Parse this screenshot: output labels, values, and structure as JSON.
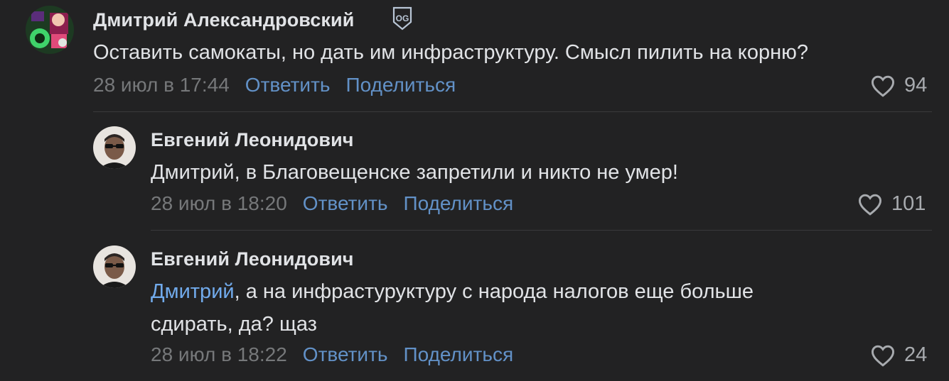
{
  "comments": [
    {
      "author": "Дмитрий Александровский",
      "badge": "OG",
      "text": "Оставить самокаты, но дать им инфраструктуру. Смысл пилить на корню?",
      "date": "28 июл в 17:44",
      "reply_label": "Ответить",
      "share_label": "Поделиться",
      "likes": "94"
    },
    {
      "author": "Евгений Леонидович",
      "text": "Дмитрий, в Благовещенске запретили и никто не умер!",
      "date": "28 июл в 18:20",
      "reply_label": "Ответить",
      "share_label": "Поделиться",
      "likes": "101"
    },
    {
      "author": "Евгений Леонидович",
      "mention": "Дмитрий",
      "text_line1": ", а на инфрастуруктуру с народа налогов еще больше",
      "text_line2": "сдирать, да? щаз",
      "date": "28 июл в 18:22",
      "reply_label": "Ответить",
      "share_label": "Поделиться",
      "likes": "24"
    }
  ],
  "colors": {
    "background": "#222223",
    "text": "#e1e3e6",
    "link": "#71aaeb",
    "meta": "#76787a"
  },
  "icons": [
    "heart-icon",
    "og-badge-icon"
  ]
}
